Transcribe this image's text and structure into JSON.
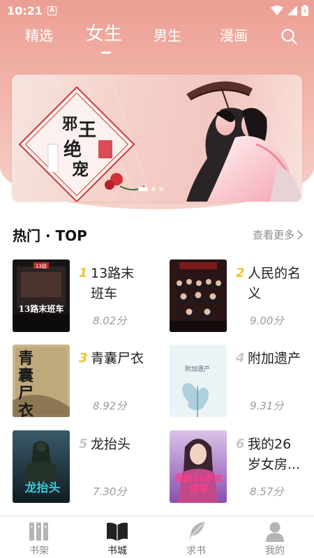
{
  "status_bar": {
    "time": "10:21",
    "notification_letter": "A"
  },
  "top_tabs": [
    {
      "label": "精选"
    },
    {
      "label": "女生",
      "active": true
    },
    {
      "label": "男生"
    },
    {
      "label": "漫画"
    }
  ],
  "search_icon": "search-icon",
  "banner": {
    "main_text": "邪王绝宠",
    "dot_count": 3
  },
  "section": {
    "title": "热门 · TOP",
    "more_label": "查看更多"
  },
  "books": [
    {
      "rank": "1",
      "title": "13路末班车",
      "score": "8.02分",
      "rank_color": "#f2c230",
      "cover_text": "13路末班车"
    },
    {
      "rank": "2",
      "title": "人民的名义",
      "score": "9.00分",
      "rank_color": "#f2c230",
      "cover_text": ""
    },
    {
      "rank": "3",
      "title": "青囊尸衣",
      "score": "8.92分",
      "rank_color": "#f2c230",
      "cover_text": "青囊尸衣"
    },
    {
      "rank": "4",
      "title": "附加遗产",
      "score": "9.31分",
      "rank_color": "#c8c8c8",
      "cover_text": "附加遗产"
    },
    {
      "rank": "5",
      "title": "龙抬头",
      "score": "7.30分",
      "rank_color": "#c8c8c8",
      "cover_text": "龙抬头"
    },
    {
      "rank": "6",
      "title": "我的26岁女房...",
      "score": "8.57分",
      "rank_color": "#c8c8c8",
      "cover_text": "我的26岁女房客"
    }
  ],
  "bottom_nav": [
    {
      "label": "书架",
      "icon": "bookshelf-icon"
    },
    {
      "label": "书城",
      "icon": "open-book-icon",
      "active": true
    },
    {
      "label": "求书",
      "icon": "feather-icon"
    },
    {
      "label": "我的",
      "icon": "person-icon"
    }
  ],
  "colors": {
    "header": "#ec9f94",
    "active_nav": "#222222",
    "inactive_nav": "#888888",
    "rank_top": "#f2c230",
    "rank_other": "#c8c8c8"
  }
}
